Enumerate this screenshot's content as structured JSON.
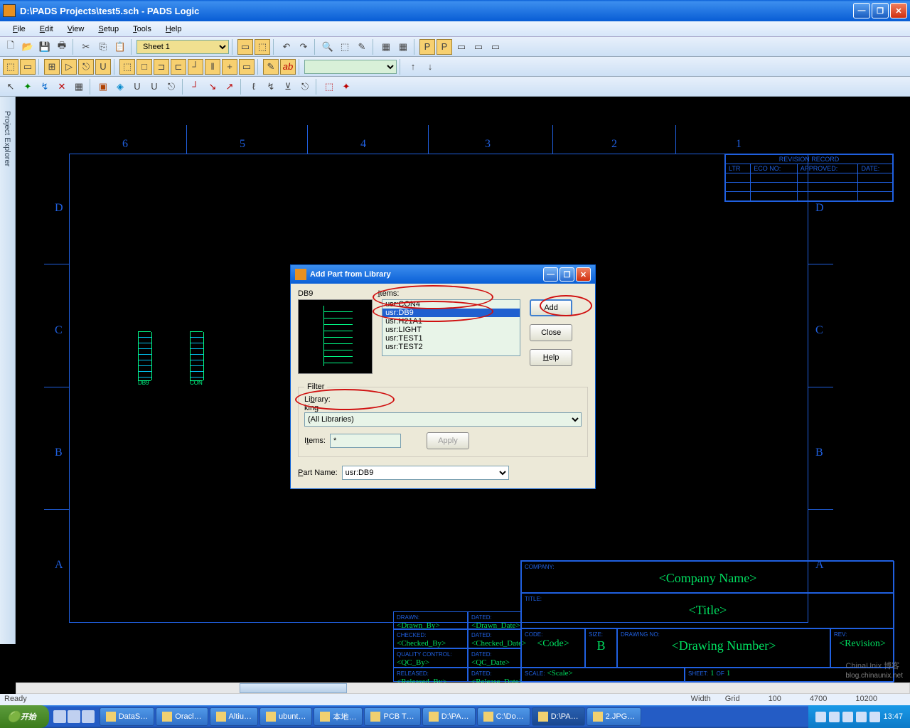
{
  "window": {
    "title": "D:\\PADS Projects\\test5.sch - PADS Logic"
  },
  "menu": {
    "file": "File",
    "edit": "Edit",
    "view": "View",
    "setup": "Setup",
    "tools": "Tools",
    "help": "Help"
  },
  "toolbar": {
    "sheet": "Sheet 1"
  },
  "sidebar": {
    "label": "Project Explorer"
  },
  "ruler": {
    "n1": "1",
    "n2": "2",
    "n3": "3",
    "n4": "4",
    "n5": "5",
    "n6": "6",
    "A": "A",
    "B": "B",
    "C": "C",
    "D": "D"
  },
  "revisionTable": {
    "title": "REVISION RECORD",
    "h1": "LTR",
    "h2": "ECO NO:",
    "h3": "APPROVED:",
    "h4": "DATE:"
  },
  "titleBlock": {
    "company_lbl": "COMPANY:",
    "company": "<Company Name>",
    "title_lbl": "TITLE:",
    "title": "<Title>",
    "drawn_lbl": "DRAWN:",
    "drawn": "<Drawn_By>",
    "dated_lbl": "DATED:",
    "dated": "<Drawn_Date>",
    "checked_lbl": "CHECKED:",
    "checked": "<Checked_By>",
    "checked_date": "<Checked_Date>",
    "quality_lbl": "QUALITY CONTROL:",
    "quality": "<QC_By>",
    "qc_date": "<QC_Date>",
    "released_lbl": "RELEASED:",
    "released": "<Released_By>",
    "release_date": "<Release_Date>",
    "code_lbl": "CODE:",
    "code": "<Code>",
    "size_lbl": "SIZE:",
    "size": "B",
    "drawing_lbl": "DRAWING NO:",
    "drawing": "<Drawing Number>",
    "rev_lbl": "REV:",
    "rev": "<Revision>",
    "scale_lbl": "SCALE:",
    "scale": "<Scale>",
    "sheet_lbl": "SHEET:",
    "sheet1": "1",
    "sheet_of": "OF",
    "sheet2": "1"
  },
  "parts": {
    "p1": "DB9",
    "p2": "CON"
  },
  "dialog": {
    "title": "Add Part from Library",
    "preview_label": "DB9",
    "items_label": "Items:",
    "items": [
      "usr:CON4",
      "usr:DB9",
      "usr:H21A1",
      "usr:LIGHT",
      "usr:TEST1",
      "usr:TEST2"
    ],
    "add": "Add",
    "close": "Close",
    "help": "Help",
    "filter_legend": "Filter",
    "library_label": "Library:",
    "library_value": "(All Libraries)",
    "items_filter_label": "Items:",
    "items_filter_value": "*",
    "apply": "Apply",
    "partname_label": "Part Name:",
    "partname_value": "usr:DB9"
  },
  "status": {
    "ready": "Ready",
    "width": "Width",
    "grid": "Grid",
    "v1": "100",
    "v2": "4700",
    "v3": "10200"
  },
  "taskbar": {
    "start": "开始",
    "tasks": [
      "DataS…",
      "Oracl…",
      "Altiu…",
      "ubunt…",
      "本地…",
      "PCB T…",
      "D:\\PA…",
      "C:\\Do…",
      "D:\\PA…",
      "2.JPG…"
    ],
    "time": "13:47"
  },
  "watermark": {
    "t1": "ChinaUnix 博客",
    "t2": "blog.chinaunix.net"
  }
}
